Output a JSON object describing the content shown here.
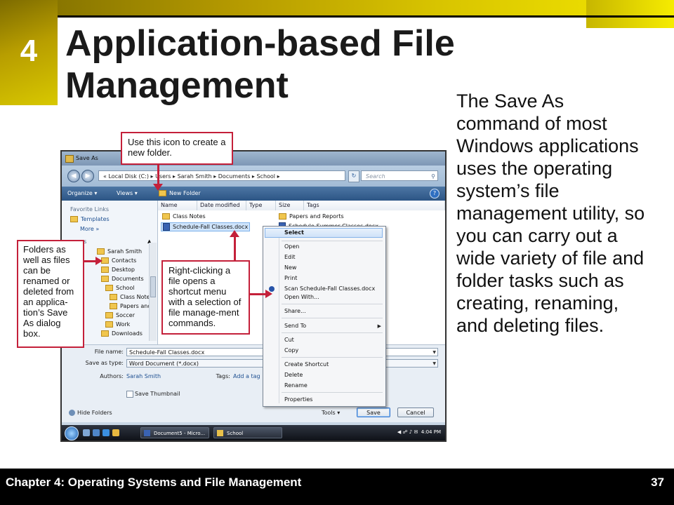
{
  "slide": {
    "chapter_number": "4",
    "title": "Application-based File Management",
    "body": "The Save As command of most Windows applications uses the operating system’s file management utility, so you can carry out a wide variety of file and folder tasks such as creating, renaming, and deleting files.",
    "footer_title": "Chapter 4: Operating Systems and File Management",
    "page_number": "37"
  },
  "colors": {
    "header_gold": "#d8c400",
    "callout_border": "#c4203a",
    "footer_bg": "#000000"
  },
  "dialog": {
    "title": "Save As",
    "address_path": "« Local Disk (C:) ▸ Users ▸ Sarah Smith ▸ Documents ▸ School ▸",
    "search_placeholder": "Search",
    "toolbar": {
      "organize": "Organize ▾",
      "views": "Views ▾",
      "new_folder": "New Folder"
    },
    "favorite_links_heading": "Favorite Links",
    "favorite_links": [
      "Templates",
      "More »"
    ],
    "tree_heading": "rs",
    "tree": [
      "Sarah Smith",
      "Contacts",
      "Desktop",
      "Documents",
      "School",
      "Class Notes",
      "Papers and",
      "Soccer",
      "Work",
      "Downloads"
    ],
    "columns": [
      "Name",
      "Date modified",
      "Type",
      "Size",
      "Tags"
    ],
    "files": [
      "Class Notes",
      "Schedule-Fall Classes.docx",
      "Papers and Reports",
      "Schedule-Summer Classes.docx"
    ],
    "context_menu": [
      "Select",
      "Open",
      "Edit",
      "New",
      "Print",
      "Scan Schedule-Fall Classes.docx",
      "Open With...",
      "Share...",
      "Send To",
      "Cut",
      "Copy",
      "Create Shortcut",
      "Delete",
      "Rename",
      "Properties"
    ],
    "file_name_label": "File name:",
    "file_name_value": "Schedule-Fall Classes.docx",
    "save_as_type_label": "Save as type:",
    "save_as_type_value": "Word Document (*.docx)",
    "authors_label": "Authors:",
    "authors_value": "Sarah Smith",
    "tags_label": "Tags:",
    "tags_value": "Add a tag",
    "save_thumbnail": "Save Thumbnail",
    "hide_folders": "Hide Folders",
    "tools": "Tools ▾",
    "save_button": "Save",
    "cancel_button": "Cancel"
  },
  "taskbar": {
    "task1": "Document5 - Micro...",
    "task2": "School",
    "time": "4:04 PM"
  },
  "callouts": {
    "new_folder": "Use this icon to create a new folder.",
    "folders": "Folders as well as files can be renamed or deleted from an applica-tion’s Save As dialog box.",
    "right_click": "Right-clicking a file opens a shortcut menu with a selection of file manage-ment commands."
  },
  "icons": {
    "back": "back-arrow-icon",
    "forward": "forward-arrow-icon",
    "refresh": "refresh-icon",
    "search": "magnifier-icon",
    "help": "help-icon",
    "folder": "folder-icon",
    "document": "word-document-icon"
  }
}
